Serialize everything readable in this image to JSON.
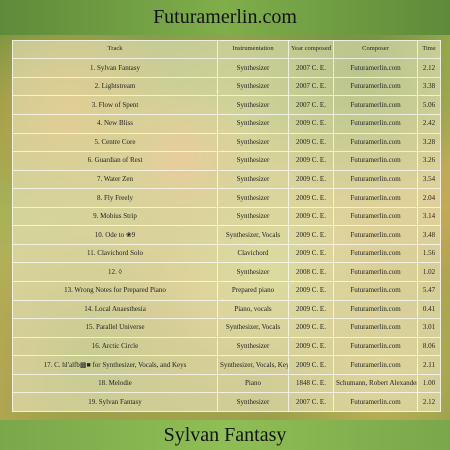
{
  "header": {
    "title": "Futuramerlin.com"
  },
  "footer": {
    "now_playing": "Sylvan Fantasy"
  },
  "table": {
    "columns": [
      "Track",
      "Instrumentation",
      "Year composed",
      "Composer",
      "Time"
    ],
    "rows": [
      [
        "1. Sylvan Fantasy",
        "Synthesizer",
        "2007 C. E.",
        "Futuramerlin.com",
        "2.12"
      ],
      [
        "2. Lightstream",
        "Synthesizer",
        "2007 C. E.",
        "Futuramerlin.com",
        "3.38"
      ],
      [
        "3. Flow of Spent",
        "Synthesizer",
        "2007 C. E.",
        "Futuramerlin.com",
        "5.06"
      ],
      [
        "4. New Bliss",
        "Synthesizer",
        "2009 C. E.",
        "Futuramerlin.com",
        "2.42"
      ],
      [
        "5. Centre Core",
        "Synthesizer",
        "2009 C. E.",
        "Futuramerlin.com",
        "3.28"
      ],
      [
        "6. Guardian of Rest",
        "Synthesizer",
        "2009 C. E.",
        "Futuramerlin.com",
        "3.26"
      ],
      [
        "7. Water Zen",
        "Synthesizer",
        "2009 C. E.",
        "Futuramerlin.com",
        "3.54"
      ],
      [
        "8. Fly Freely",
        "Synthesizer",
        "2009 C. E.",
        "Futuramerlin.com",
        "2.04"
      ],
      [
        "9. Mobius Strip",
        "Synthesizer",
        "2009 C. E.",
        "Futuramerlin.com",
        "3.14"
      ],
      [
        "10. Ode to ❀9",
        "Synthesizer, Vocals",
        "2009 C. E.",
        "Futuramerlin.com",
        "3.48"
      ],
      [
        "11. Clavichord Solo",
        "Clavichord",
        "2009 C. E.",
        "Futuramerlin.com",
        "1.56"
      ],
      [
        "12. ◊",
        "Synthesizer",
        "2008 C. E.",
        "Futuramerlin.com",
        "1.02"
      ],
      [
        "13. Wrong Notes for Prepared Piano",
        "Prepared piano",
        "2009 C. E.",
        "Futuramerlin.com",
        "5.47"
      ],
      [
        "14. Local Anaesthesia",
        "Piano, vocals",
        "2009 C. E.",
        "Futuramerlin.com",
        "0.41"
      ],
      [
        "15. Parallel Universe",
        "Synthesizer, Vocals",
        "2009 C. E.",
        "Futuramerlin.com",
        "3.01"
      ],
      [
        "16. Arctic Circle",
        "Synthesizer",
        "2009 C. E.",
        "Futuramerlin.com",
        "8.06"
      ],
      [
        "17. C. hl'alfb▩■ for Synthesizer, Vocals, and Keys",
        "Synthesizer, Vocals, Keys",
        "2009 C. E.",
        "Futuramerlin.com",
        "2.11"
      ],
      [
        "18. Melodie",
        "Piano",
        "1848 C. E.",
        "Schumann, Robert Alexander",
        "1.00"
      ],
      [
        "19. Sylvan Fantasy",
        "Synthesizer",
        "2007 C. E.",
        "Futuramerlin.com",
        "2.12"
      ]
    ]
  }
}
